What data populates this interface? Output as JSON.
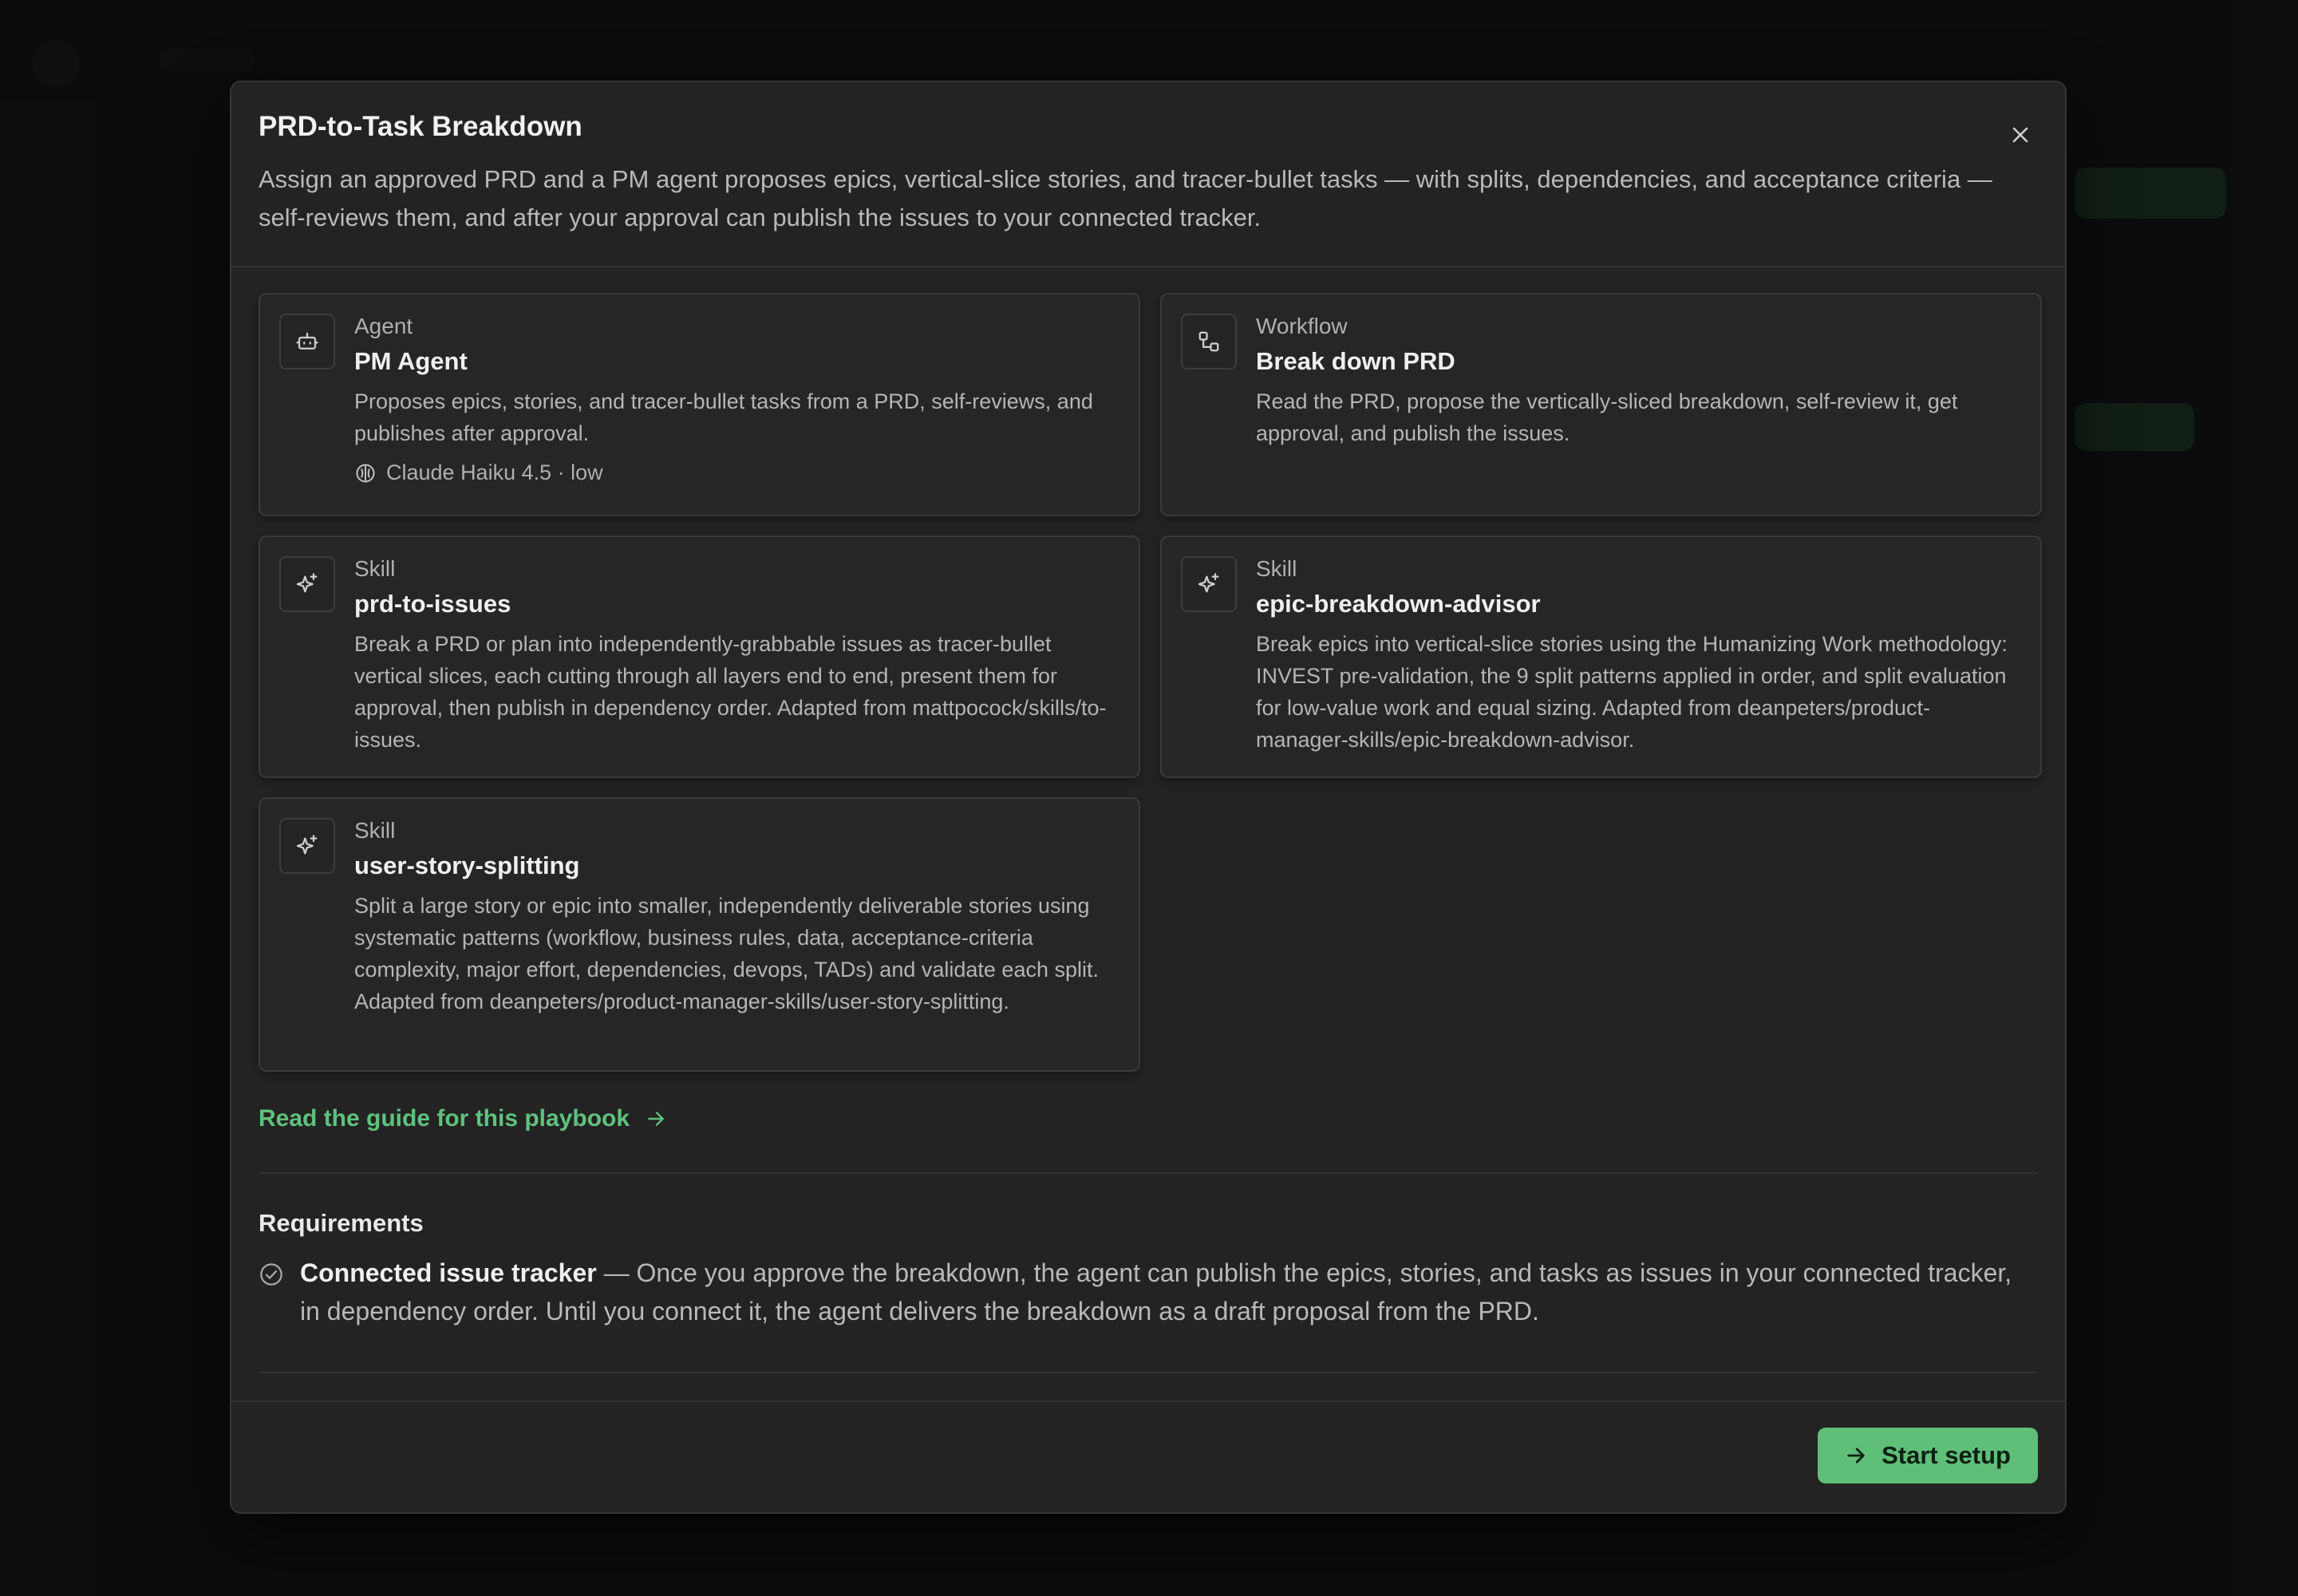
{
  "modal": {
    "title": "PRD-to-Task Breakdown",
    "description": "Assign an approved PRD and a PM agent proposes epics, vertical-slice stories, and tracer-bullet tasks — with splits, dependencies, and acceptance criteria — self-reviews them, and after your approval can publish the issues to your connected tracker.",
    "close_icon": "close-icon"
  },
  "cards": [
    {
      "kind": "Agent",
      "name": "PM Agent",
      "text": "Proposes epics, stories, and tracer-bullet tasks from a PRD, self-reviews, and publishes after approval.",
      "meta": "Claude Haiku 4.5 · low",
      "icon": "robot-icon"
    },
    {
      "kind": "Workflow",
      "name": "Break down PRD",
      "text": "Read the PRD, propose the vertically-sliced breakdown, self-review it, get approval, and publish the issues.",
      "icon": "workflow-icon"
    },
    {
      "kind": "Skill",
      "name": "prd-to-issues",
      "text": "Break a PRD or plan into independently-grabbable issues as tracer-bullet vertical slices, each cutting through all layers end to end, present them for approval, then publish in dependency order. Adapted from mattpocock/skills/to-issues.",
      "icon": "sparkle-icon"
    },
    {
      "kind": "Skill",
      "name": "epic-breakdown-advisor",
      "text": "Break epics into vertical-slice stories using the Humanizing Work methodology: INVEST pre-validation, the 9 split patterns applied in order, and split evaluation for low-value work and equal sizing. Adapted from deanpeters/product-manager-skills/epic-breakdown-advisor.",
      "icon": "sparkle-icon"
    },
    {
      "kind": "Skill",
      "name": "user-story-splitting",
      "text": "Split a large story or epic into smaller, independently deliverable stories using systematic patterns (workflow, business rules, data, acceptance-criteria complexity, major effort, dependencies, devops, TADs) and validate each split. Adapted from deanpeters/product-manager-skills/user-story-splitting.",
      "icon": "sparkle-icon"
    }
  ],
  "guide_link": "Read the guide for this playbook",
  "requirements": {
    "title": "Requirements",
    "item_name": "Connected issue tracker",
    "item_text": " — Once you approve the breakdown, the agent can publish the epics, stories, and tasks as issues in your connected tracker, in dependency order. Until you connect it, the agent delivers the breakdown as a draft proposal from the PRD."
  },
  "footer": {
    "start_label": "Start setup"
  },
  "colors": {
    "accent": "#5fbf78",
    "modal_bg": "#232323",
    "card_bg": "#262626"
  }
}
